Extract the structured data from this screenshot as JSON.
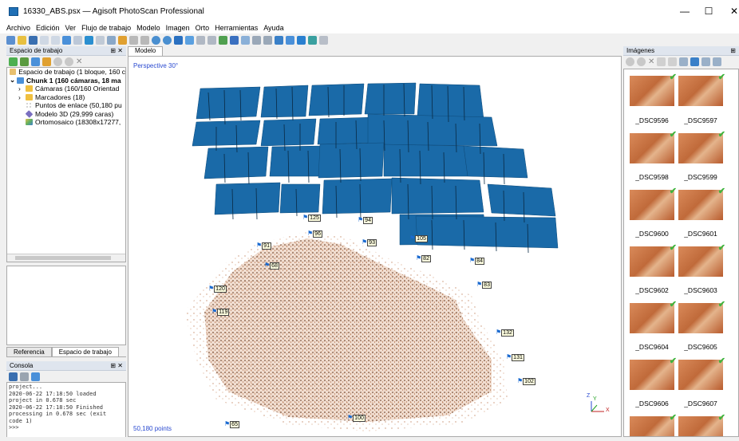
{
  "window": {
    "title": "16330_ABS.psx — Agisoft PhotoScan Professional",
    "minimize": "—",
    "maximize": "☐",
    "close": "✕"
  },
  "menu": [
    "Archivo",
    "Edición",
    "Ver",
    "Flujo de trabajo",
    "Modelo",
    "Imagen",
    "Orto",
    "Herramientas",
    "Ayuda"
  ],
  "workspace": {
    "title": "Espacio de trabajo",
    "pin": "⊞ ✕",
    "items": [
      {
        "label": "Espacio de trabajo (1 bloque, 160 c"
      },
      {
        "label": "Chunk 1 (160 cámaras, 18 ma"
      },
      {
        "label": "Cámaras (160/160 Orientad"
      },
      {
        "label": "Marcadores (18)"
      },
      {
        "label": "Puntos de enlace (50,180 pu"
      },
      {
        "label": "Modelo 3D (29,999 caras)"
      },
      {
        "label": "Ortomosaico (18308x17277,"
      }
    ],
    "tabs": [
      "Referencia",
      "Espacio de trabajo"
    ]
  },
  "console": {
    "title": "Consola",
    "lines": "project...\n2020-06-22 17:18:50 loaded\nproject in 0.678 sec\n2020-06-22 17:18:50 Finished\nprocessing in 0.678 sec (exit\ncode 1)\n>>>"
  },
  "model": {
    "tab": "Modelo",
    "perspective": "Perspective 30°",
    "points": "50,180 points",
    "axes": {
      "x": "X",
      "y": "Y",
      "z": "Z"
    },
    "markers": [
      "125",
      "94",
      "96",
      "93",
      "105",
      "91",
      "68",
      "82",
      "84",
      "83",
      "120",
      "119",
      "132",
      "131",
      "102",
      "100",
      "65"
    ]
  },
  "images": {
    "title": "Imágenes",
    "labels": [
      "_DSC9596",
      "_DSC9597",
      "_DSC9598",
      "_DSC9599",
      "_DSC9600",
      "_DSC9601",
      "_DSC9602",
      "_DSC9603",
      "_DSC9604",
      "_DSC9605",
      "_DSC9606",
      "_DSC9607"
    ],
    "check": "✔"
  }
}
